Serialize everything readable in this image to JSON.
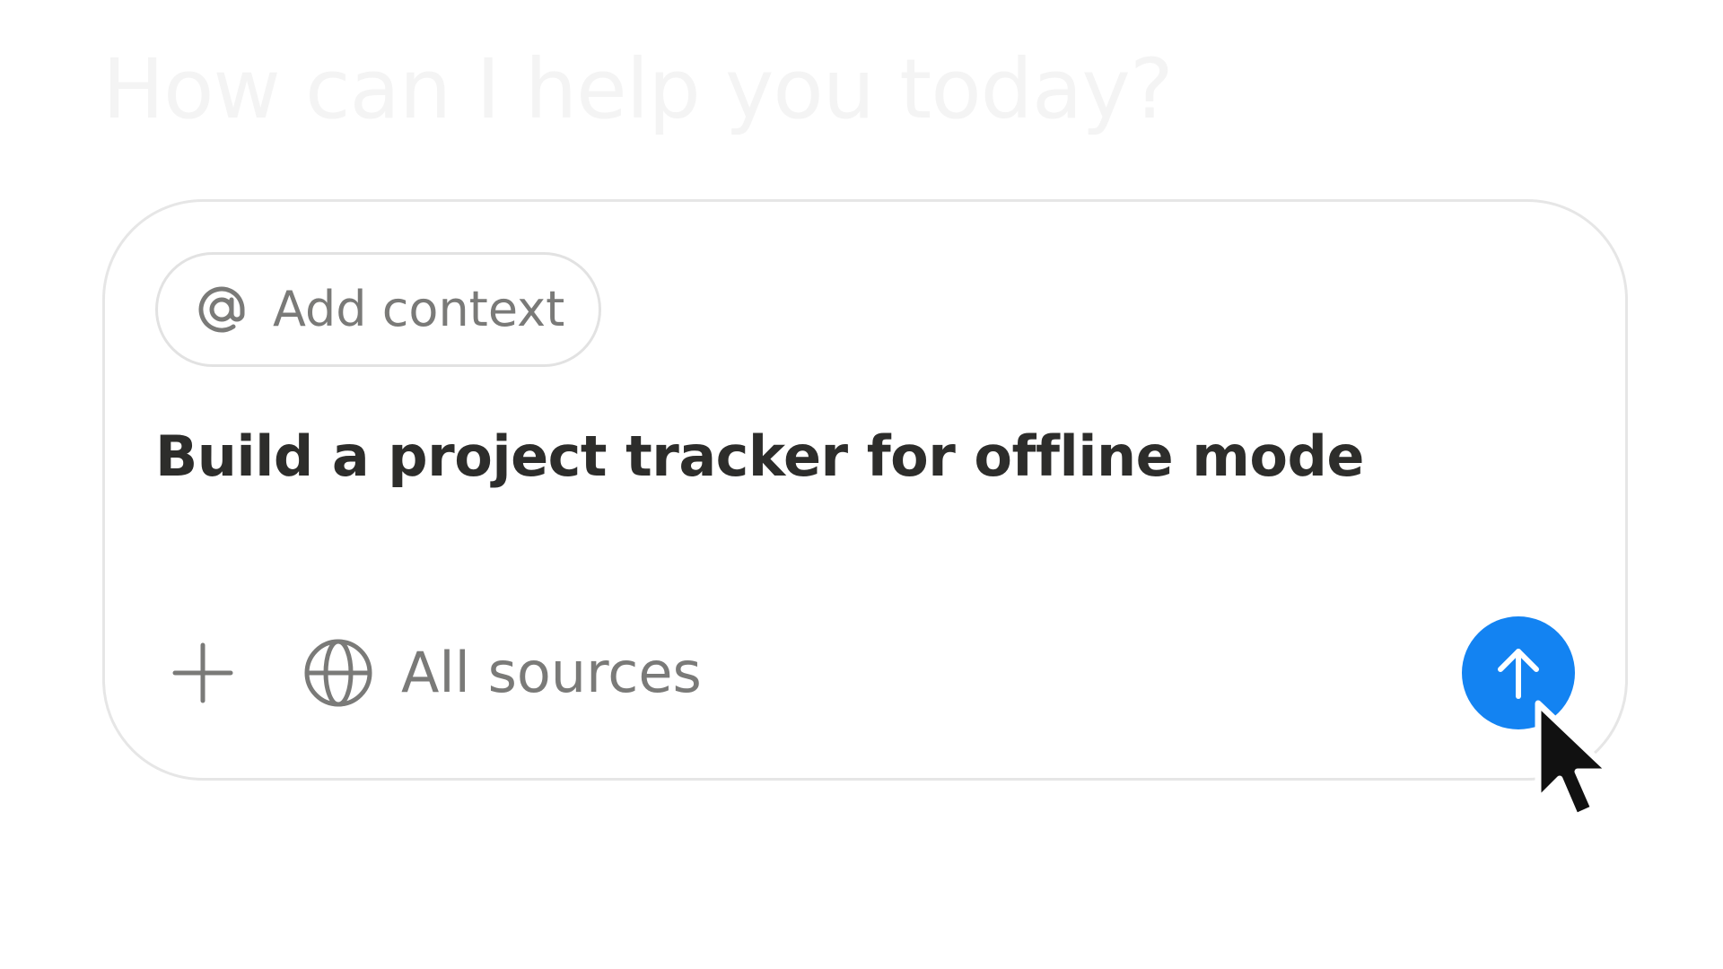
{
  "heading": "How can I help you today?",
  "composer": {
    "context_button_label": "Add context",
    "prompt_text": "Build a project tracker for offline mode",
    "sources_label": "All sources"
  },
  "icons": {
    "context": "at-sign-icon",
    "add": "plus-icon",
    "sources": "globe-icon",
    "send": "arrow-up-icon",
    "pointer": "mouse-cursor-icon"
  },
  "colors": {
    "send_button": "#1383f2",
    "prompt_text": "#2d2d2b",
    "secondary_text": "#7a7a78"
  }
}
